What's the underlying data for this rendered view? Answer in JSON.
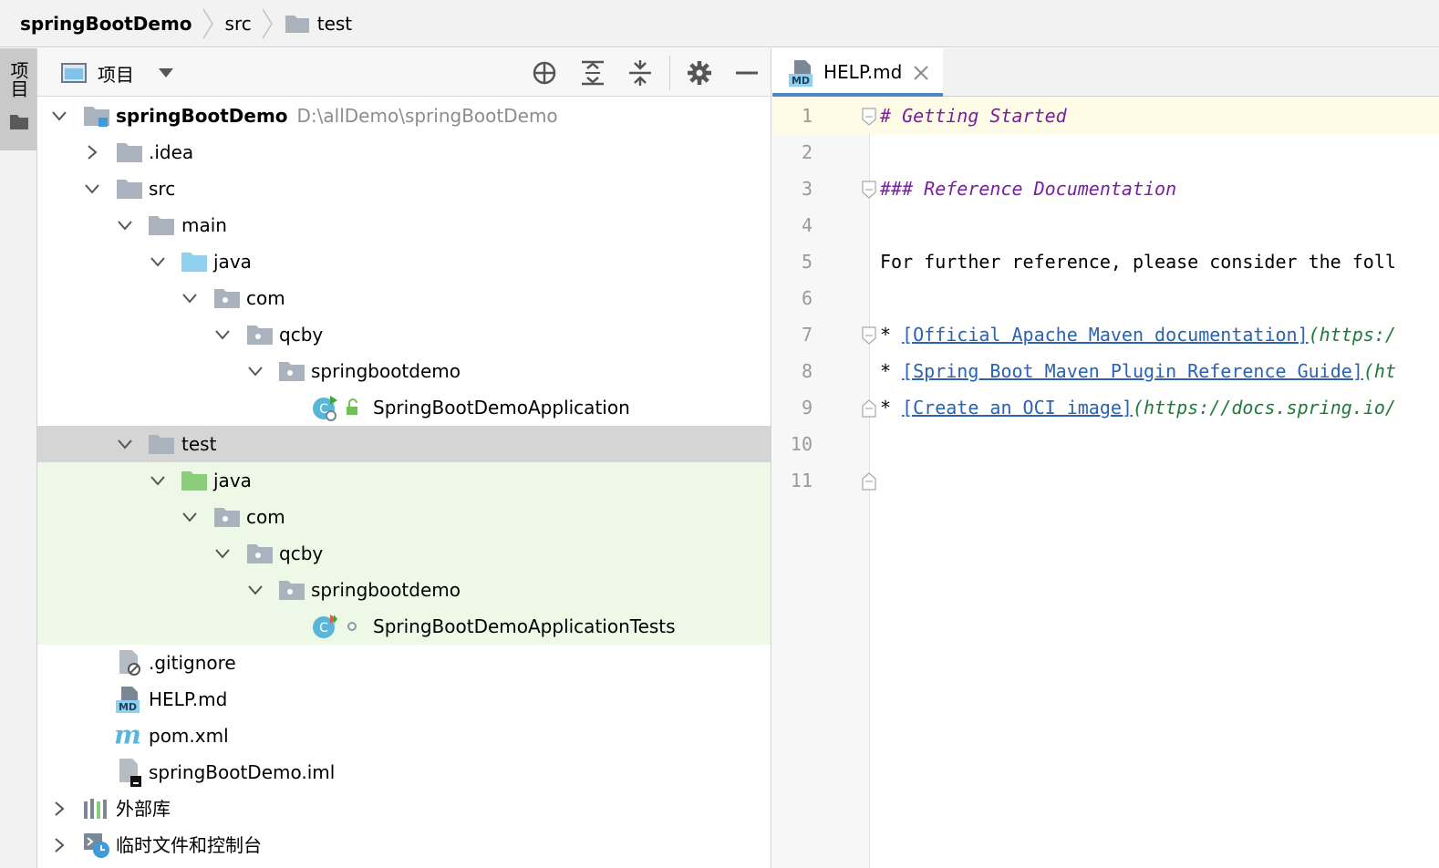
{
  "breadcrumb": {
    "root": "springBootDemo",
    "src": "src",
    "test": "test"
  },
  "toolstrip": {
    "project_label": "项目"
  },
  "project_panel": {
    "view_label": "项目",
    "header_icons": [
      "locate-icon",
      "expand-all-icon",
      "collapse-all-icon",
      "gear-icon",
      "minimize-icon"
    ]
  },
  "tree": {
    "root_name": "springBootDemo",
    "root_path": "D:\\allDemo\\springBootDemo",
    "idea": ".idea",
    "src": "src",
    "main": "main",
    "main_java": "java",
    "main_com": "com",
    "main_qcby": "qcby",
    "main_pkg": "springbootdemo",
    "main_class": "SpringBootDemoApplication",
    "test": "test",
    "test_java": "java",
    "test_com": "com",
    "test_qcby": "qcby",
    "test_pkg": "springbootdemo",
    "test_class": "SpringBootDemoApplicationTests",
    "gitignore": ".gitignore",
    "help": "HELP.md",
    "pom": "pom.xml",
    "iml": "springBootDemo.iml",
    "external_libs": "外部库",
    "scratches": "临时文件和控制台"
  },
  "editor": {
    "tab_label": "HELP.md",
    "lines": [
      {
        "n": "1",
        "heading": "# Getting Started"
      },
      {
        "n": "2"
      },
      {
        "n": "3",
        "heading": "### Reference Documentation"
      },
      {
        "n": "4"
      },
      {
        "n": "5",
        "text": "For further reference, please consider the foll"
      },
      {
        "n": "6"
      },
      {
        "n": "7",
        "bullet": "* ",
        "link": "[Official Apache Maven documentation]",
        "url": "(https:/"
      },
      {
        "n": "8",
        "bullet": "* ",
        "link": "[Spring Boot Maven Plugin Reference Guide]",
        "url": "(ht"
      },
      {
        "n": "9",
        "bullet": "* ",
        "link": "[Create an OCI image]",
        "url": "(https://docs.spring.io/"
      },
      {
        "n": "10"
      },
      {
        "n": "11"
      }
    ]
  },
  "colors": {
    "selection": "#d5d5d5",
    "test_bg": "#eef8e6",
    "folder_gray": "#aab2bd",
    "source_blue": "#8fd0ee",
    "test_green": "#8ccd7c",
    "heading": "#7a1fa2",
    "link": "#2a62b4",
    "url": "#1e7a3a",
    "tab_accent": "#4a88c7"
  }
}
